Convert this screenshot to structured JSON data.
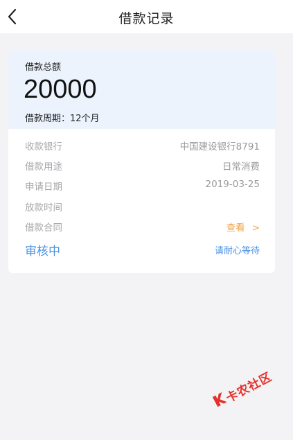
{
  "nav": {
    "title": "借款记录",
    "back_icon": "chevron-left-icon"
  },
  "summary": {
    "total_label": "借款总额",
    "amount": "20000",
    "period": "借款周期：12个月"
  },
  "details": [
    {
      "key": "收款银行",
      "value": "中国建设银行8791"
    },
    {
      "key": "借款用途",
      "value": "日常消费"
    },
    {
      "key": "申请日期",
      "value": "2019-03-25"
    },
    {
      "key": "放款时间",
      "value": ""
    },
    {
      "key": "借款合同",
      "value": "查看",
      "chevron": ">"
    }
  ],
  "status": {
    "label": "审核中",
    "hint": "请耐心等待"
  },
  "watermark": {
    "text": "卡农社区",
    "mark": "K"
  },
  "colors": {
    "accent": "#4a90e2",
    "link": "#f0a346",
    "header_bg": "#ecf3fd",
    "watermark": "#e4312b"
  }
}
